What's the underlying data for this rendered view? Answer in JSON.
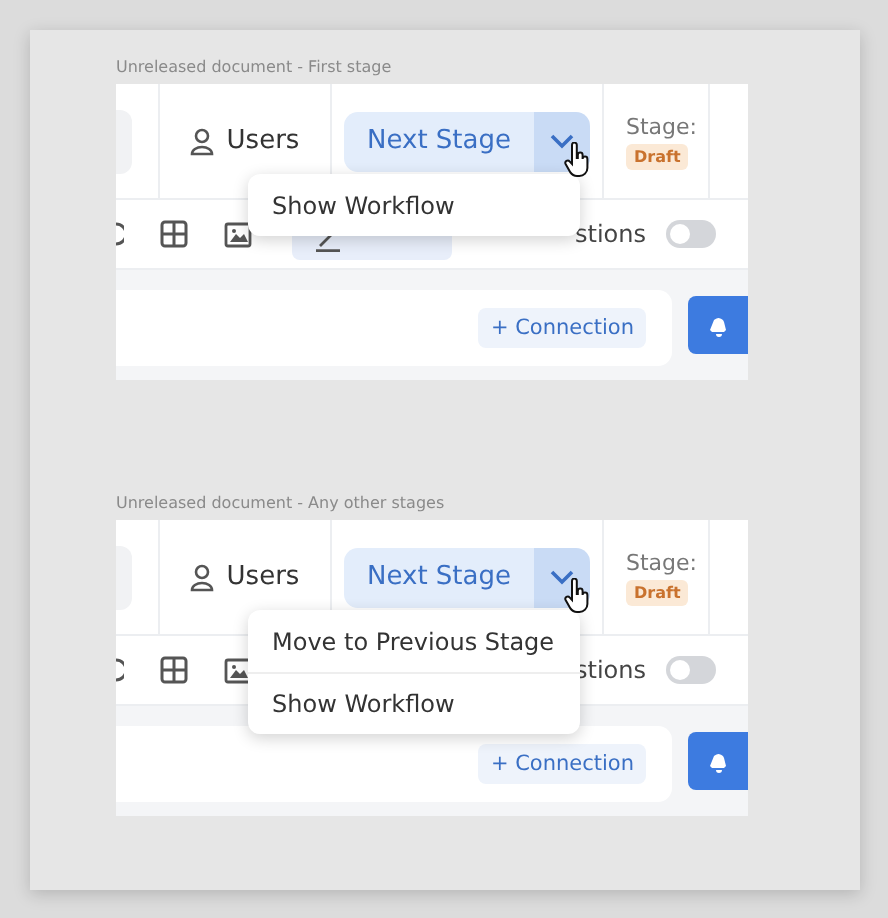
{
  "panels": [
    {
      "caption": "Unreleased document - First stage",
      "users_label": "Users",
      "primary_button": "Next Stage",
      "stage_label": "Stage:",
      "stage_badge": "Draft",
      "toolbar": {
        "mode_button": true,
        "suggestions_label": "stions",
        "suggestions_on": false
      },
      "connection_button": "+ Connection",
      "menu": [
        "Show Workflow"
      ]
    },
    {
      "caption": "Unreleased document - Any other stages",
      "users_label": "Users",
      "primary_button": "Next Stage",
      "stage_label": "Stage:",
      "stage_badge": "Draft",
      "toolbar": {
        "mode_button": false,
        "suggestions_label": "stions",
        "suggestions_on": false
      },
      "connection_button": "+ Connection",
      "menu": [
        "Move to Previous Stage",
        "Show Workflow"
      ]
    }
  ]
}
